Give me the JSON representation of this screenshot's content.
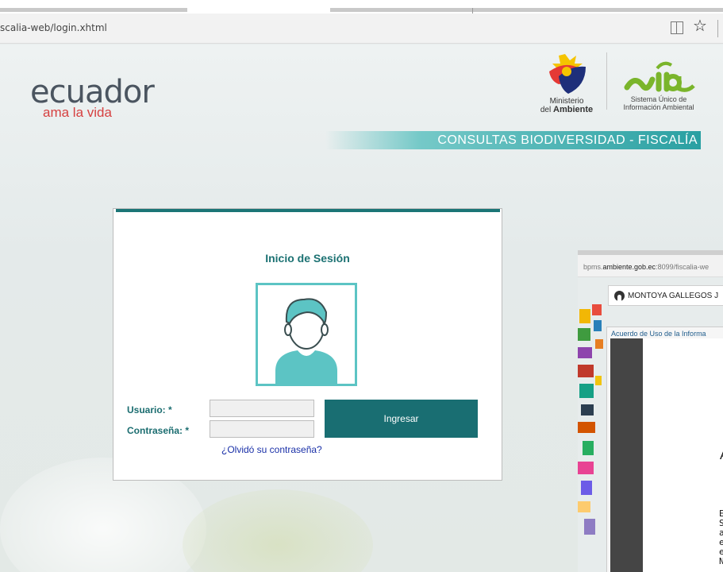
{
  "browser": {
    "url": "scalia-web/login.xhtml",
    "icons": [
      "reading-view-icon",
      "favorite-star-icon"
    ]
  },
  "header": {
    "brand_main": "ecuador",
    "brand_sub": "ama la vida",
    "ministerio_line1": "Ministerio",
    "ministerio_prefix": "del ",
    "ministerio_bold": "Ambiente",
    "suia_line1": "Sistema Único de",
    "suia_line2": "Información Ambiental",
    "banner": "CONSULTAS BIODIVERSIDAD - FISCALÍA"
  },
  "login": {
    "title": "Inicio de Sesión",
    "user_label": "Usuario: *",
    "user_value": "",
    "password_label": "Contraseña: *",
    "password_value": "",
    "submit_label": "Ingresar",
    "forgot_link": "¿Olvidó su contraseña?"
  },
  "secondary_window": {
    "url_host": "bpms.",
    "url_domain": "ambiente.gob.ec",
    "url_rest": ":8099/fiscalia-we",
    "user_name": "MONTOYA GALLEGOS J",
    "dialog_title": "Acuerdo de Uso de la Informa",
    "doc_letter": "A",
    "doc_lines": [
      "E",
      "S",
      "a",
      "e",
      "e",
      "N"
    ]
  },
  "colors": {
    "accent": "#1b7576",
    "avatar": "#5cc4c4",
    "banner": "#2aa0a2",
    "link": "#1a30a8",
    "brand_red": "#d64040"
  }
}
